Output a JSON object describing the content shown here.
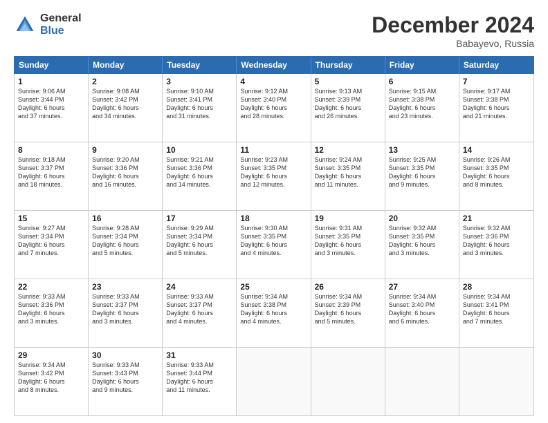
{
  "logo": {
    "general": "General",
    "blue": "Blue"
  },
  "title": "December 2024",
  "location": "Babayevo, Russia",
  "days_header": [
    "Sunday",
    "Monday",
    "Tuesday",
    "Wednesday",
    "Thursday",
    "Friday",
    "Saturday"
  ],
  "weeks": [
    [
      {
        "day": "1",
        "lines": [
          "Sunrise: 9:06 AM",
          "Sunset: 3:44 PM",
          "Daylight: 6 hours",
          "and 37 minutes."
        ]
      },
      {
        "day": "2",
        "lines": [
          "Sunrise: 9:08 AM",
          "Sunset: 3:42 PM",
          "Daylight: 6 hours",
          "and 34 minutes."
        ]
      },
      {
        "day": "3",
        "lines": [
          "Sunrise: 9:10 AM",
          "Sunset: 3:41 PM",
          "Daylight: 6 hours",
          "and 31 minutes."
        ]
      },
      {
        "day": "4",
        "lines": [
          "Sunrise: 9:12 AM",
          "Sunset: 3:40 PM",
          "Daylight: 6 hours",
          "and 28 minutes."
        ]
      },
      {
        "day": "5",
        "lines": [
          "Sunrise: 9:13 AM",
          "Sunset: 3:39 PM",
          "Daylight: 6 hours",
          "and 26 minutes."
        ]
      },
      {
        "day": "6",
        "lines": [
          "Sunrise: 9:15 AM",
          "Sunset: 3:38 PM",
          "Daylight: 6 hours",
          "and 23 minutes."
        ]
      },
      {
        "day": "7",
        "lines": [
          "Sunrise: 9:17 AM",
          "Sunset: 3:38 PM",
          "Daylight: 6 hours",
          "and 21 minutes."
        ]
      }
    ],
    [
      {
        "day": "8",
        "lines": [
          "Sunrise: 9:18 AM",
          "Sunset: 3:37 PM",
          "Daylight: 6 hours",
          "and 18 minutes."
        ]
      },
      {
        "day": "9",
        "lines": [
          "Sunrise: 9:20 AM",
          "Sunset: 3:36 PM",
          "Daylight: 6 hours",
          "and 16 minutes."
        ]
      },
      {
        "day": "10",
        "lines": [
          "Sunrise: 9:21 AM",
          "Sunset: 3:36 PM",
          "Daylight: 6 hours",
          "and 14 minutes."
        ]
      },
      {
        "day": "11",
        "lines": [
          "Sunrise: 9:23 AM",
          "Sunset: 3:35 PM",
          "Daylight: 6 hours",
          "and 12 minutes."
        ]
      },
      {
        "day": "12",
        "lines": [
          "Sunrise: 9:24 AM",
          "Sunset: 3:35 PM",
          "Daylight: 6 hours",
          "and 11 minutes."
        ]
      },
      {
        "day": "13",
        "lines": [
          "Sunrise: 9:25 AM",
          "Sunset: 3:35 PM",
          "Daylight: 6 hours",
          "and 9 minutes."
        ]
      },
      {
        "day": "14",
        "lines": [
          "Sunrise: 9:26 AM",
          "Sunset: 3:35 PM",
          "Daylight: 6 hours",
          "and 8 minutes."
        ]
      }
    ],
    [
      {
        "day": "15",
        "lines": [
          "Sunrise: 9:27 AM",
          "Sunset: 3:34 PM",
          "Daylight: 6 hours",
          "and 7 minutes."
        ]
      },
      {
        "day": "16",
        "lines": [
          "Sunrise: 9:28 AM",
          "Sunset: 3:34 PM",
          "Daylight: 6 hours",
          "and 5 minutes."
        ]
      },
      {
        "day": "17",
        "lines": [
          "Sunrise: 9:29 AM",
          "Sunset: 3:34 PM",
          "Daylight: 6 hours",
          "and 5 minutes."
        ]
      },
      {
        "day": "18",
        "lines": [
          "Sunrise: 9:30 AM",
          "Sunset: 3:35 PM",
          "Daylight: 6 hours",
          "and 4 minutes."
        ]
      },
      {
        "day": "19",
        "lines": [
          "Sunrise: 9:31 AM",
          "Sunset: 3:35 PM",
          "Daylight: 6 hours",
          "and 3 minutes."
        ]
      },
      {
        "day": "20",
        "lines": [
          "Sunrise: 9:32 AM",
          "Sunset: 3:35 PM",
          "Daylight: 6 hours",
          "and 3 minutes."
        ]
      },
      {
        "day": "21",
        "lines": [
          "Sunrise: 9:32 AM",
          "Sunset: 3:36 PM",
          "Daylight: 6 hours",
          "and 3 minutes."
        ]
      }
    ],
    [
      {
        "day": "22",
        "lines": [
          "Sunrise: 9:33 AM",
          "Sunset: 3:36 PM",
          "Daylight: 6 hours",
          "and 3 minutes."
        ]
      },
      {
        "day": "23",
        "lines": [
          "Sunrise: 9:33 AM",
          "Sunset: 3:37 PM",
          "Daylight: 6 hours",
          "and 3 minutes."
        ]
      },
      {
        "day": "24",
        "lines": [
          "Sunrise: 9:33 AM",
          "Sunset: 3:37 PM",
          "Daylight: 6 hours",
          "and 4 minutes."
        ]
      },
      {
        "day": "25",
        "lines": [
          "Sunrise: 9:34 AM",
          "Sunset: 3:38 PM",
          "Daylight: 6 hours",
          "and 4 minutes."
        ]
      },
      {
        "day": "26",
        "lines": [
          "Sunrise: 9:34 AM",
          "Sunset: 3:39 PM",
          "Daylight: 6 hours",
          "and 5 minutes."
        ]
      },
      {
        "day": "27",
        "lines": [
          "Sunrise: 9:34 AM",
          "Sunset: 3:40 PM",
          "Daylight: 6 hours",
          "and 6 minutes."
        ]
      },
      {
        "day": "28",
        "lines": [
          "Sunrise: 9:34 AM",
          "Sunset: 3:41 PM",
          "Daylight: 6 hours",
          "and 7 minutes."
        ]
      }
    ],
    [
      {
        "day": "29",
        "lines": [
          "Sunrise: 9:34 AM",
          "Sunset: 3:42 PM",
          "Daylight: 6 hours",
          "and 8 minutes."
        ]
      },
      {
        "day": "30",
        "lines": [
          "Sunrise: 9:33 AM",
          "Sunset: 3:43 PM",
          "Daylight: 6 hours",
          "and 9 minutes."
        ]
      },
      {
        "day": "31",
        "lines": [
          "Sunrise: 9:33 AM",
          "Sunset: 3:44 PM",
          "Daylight: 6 hours",
          "and 11 minutes."
        ]
      },
      null,
      null,
      null,
      null
    ]
  ]
}
